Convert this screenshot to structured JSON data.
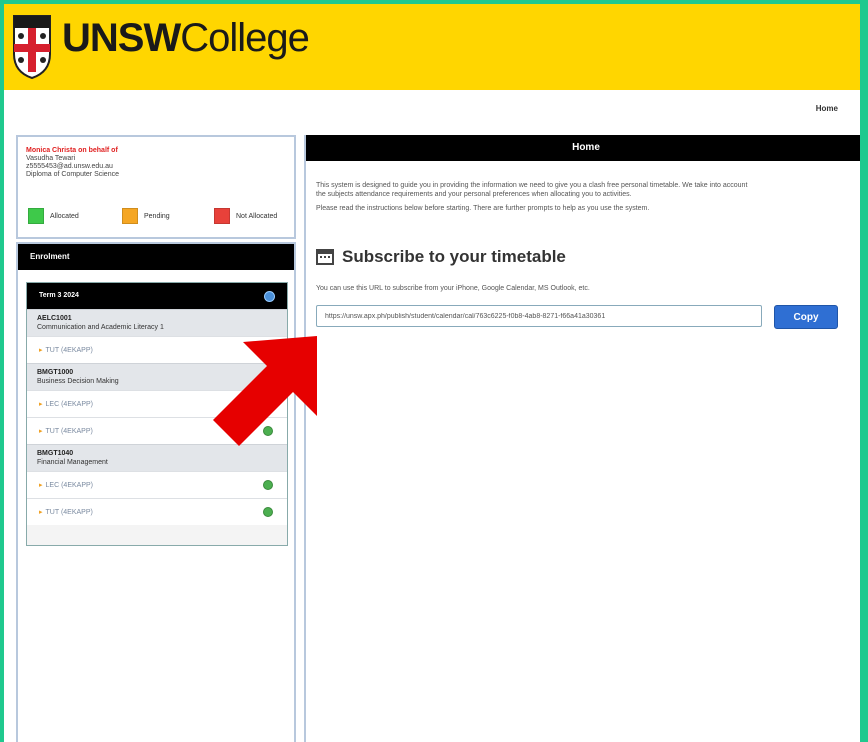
{
  "brand": {
    "name_bold": "UNSW",
    "name_light": "College"
  },
  "topnav": {
    "home_link": "Home"
  },
  "user": {
    "acting_as": "Monica Christa on behalf of",
    "name": "Vasudha Tewari",
    "email": "z5555453@ad.unsw.edu.au",
    "program": "Diploma of Computer Science"
  },
  "legend": [
    {
      "label": "Allocated",
      "color": "#3ec94a"
    },
    {
      "label": "Pending",
      "color": "#f5a623"
    },
    {
      "label": "Not Allocated",
      "color": "#e8413a"
    }
  ],
  "enrollment": {
    "header": "Enrolment",
    "term": "Term 3 2024",
    "courses": [
      {
        "code": "AELC1001",
        "name": "Communication and Academic Literacy 1",
        "activities": [
          {
            "type": "TUT",
            "note": "(4EKAPP)"
          }
        ]
      },
      {
        "code": "BMGT1000",
        "name": "Business Decision Making",
        "activities": [
          {
            "type": "LEC",
            "note": "(4EKAPP)"
          },
          {
            "type": "TUT",
            "note": "(4EKAPP)"
          }
        ]
      },
      {
        "code": "BMGT1040",
        "name": "Financial Management",
        "activities": [
          {
            "type": "LEC",
            "note": "(4EKAPP)"
          },
          {
            "type": "TUT",
            "note": "(4EKAPP)"
          }
        ]
      }
    ]
  },
  "main": {
    "header": "Home",
    "intro_line1": "This system is designed to guide you in providing the information we need to give you a clash free personal timetable. We take into account",
    "intro_line2": "the subjects attendance requirements and your personal preferences when allocating you to activities.",
    "intro_line3": "Please read the instructions below before starting. There are further prompts to help as you use the system.",
    "subscribe_title": "Subscribe to your timetable",
    "subscribe_desc": "You can use this URL to subscribe from your iPhone, Google Calendar, MS Outlook, etc.",
    "subscribe_url": "https://unsw.apx.ph/publish/student/calendar/cal/763c6225-f0b8-4ab8-8271-f66a41a30361",
    "copy_label": "Copy"
  },
  "colors": {
    "banner": "#ffd600",
    "accent": "#2f6fd3",
    "arrow": "#e60000"
  }
}
